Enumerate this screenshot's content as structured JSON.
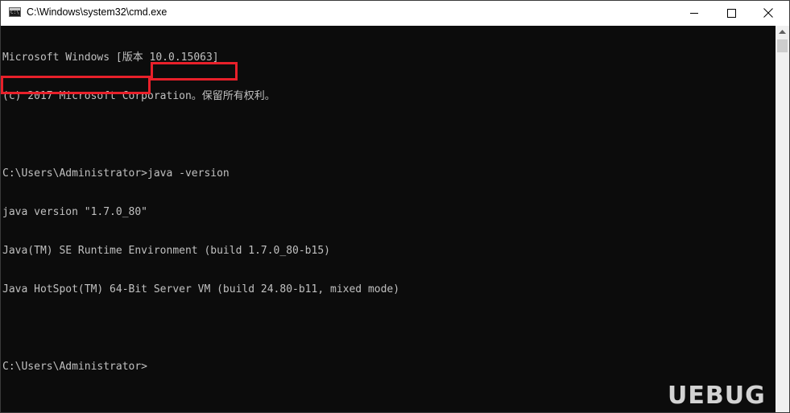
{
  "window": {
    "title": "C:\\Windows\\system32\\cmd.exe",
    "icon": "cmd-icon",
    "controls": {
      "minimize_icon": "minimize-icon",
      "maximize_icon": "maximize-icon",
      "close_icon": "close-icon"
    }
  },
  "console": {
    "background": "#0c0c0c",
    "text_color": "#c0c0c0",
    "lines": [
      "Microsoft Windows [版本 10.0.15063]",
      "(c) 2017 Microsoft Corporation。保留所有权利。",
      "",
      "C:\\Users\\Administrator>java -version",
      "java version \"1.7.0_80\"",
      "Java(TM) SE Runtime Environment (build 1.7.0_80-b15)",
      "Java HotSpot(TM) 64-Bit Server VM (build 24.80-b11, mixed mode)",
      "",
      "C:\\Users\\Administrator>"
    ]
  },
  "annotations": {
    "highlight_color": "#e8202a"
  },
  "watermark": {
    "text": "UEBUG"
  }
}
